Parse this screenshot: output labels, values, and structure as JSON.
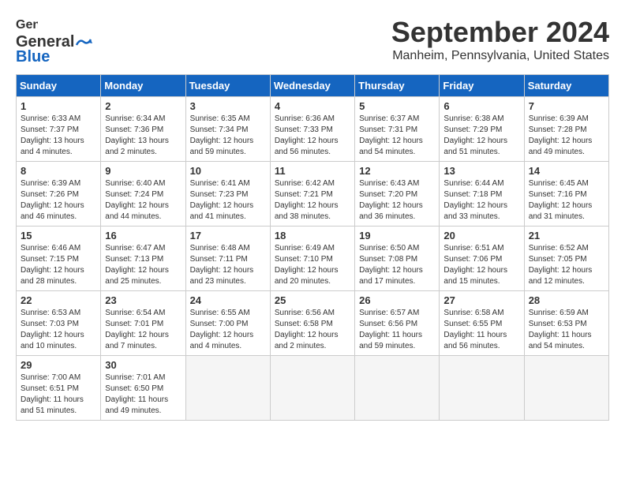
{
  "logo": {
    "general": "General",
    "blue": "Blue"
  },
  "title": "September 2024",
  "location": "Manheim, Pennsylvania, United States",
  "days_of_week": [
    "Sunday",
    "Monday",
    "Tuesday",
    "Wednesday",
    "Thursday",
    "Friday",
    "Saturday"
  ],
  "weeks": [
    [
      {
        "day": "1",
        "info": "Sunrise: 6:33 AM\nSunset: 7:37 PM\nDaylight: 13 hours and 4 minutes."
      },
      {
        "day": "2",
        "info": "Sunrise: 6:34 AM\nSunset: 7:36 PM\nDaylight: 13 hours and 2 minutes."
      },
      {
        "day": "3",
        "info": "Sunrise: 6:35 AM\nSunset: 7:34 PM\nDaylight: 12 hours and 59 minutes."
      },
      {
        "day": "4",
        "info": "Sunrise: 6:36 AM\nSunset: 7:33 PM\nDaylight: 12 hours and 56 minutes."
      },
      {
        "day": "5",
        "info": "Sunrise: 6:37 AM\nSunset: 7:31 PM\nDaylight: 12 hours and 54 minutes."
      },
      {
        "day": "6",
        "info": "Sunrise: 6:38 AM\nSunset: 7:29 PM\nDaylight: 12 hours and 51 minutes."
      },
      {
        "day": "7",
        "info": "Sunrise: 6:39 AM\nSunset: 7:28 PM\nDaylight: 12 hours and 49 minutes."
      }
    ],
    [
      {
        "day": "8",
        "info": "Sunrise: 6:39 AM\nSunset: 7:26 PM\nDaylight: 12 hours and 46 minutes."
      },
      {
        "day": "9",
        "info": "Sunrise: 6:40 AM\nSunset: 7:24 PM\nDaylight: 12 hours and 44 minutes."
      },
      {
        "day": "10",
        "info": "Sunrise: 6:41 AM\nSunset: 7:23 PM\nDaylight: 12 hours and 41 minutes."
      },
      {
        "day": "11",
        "info": "Sunrise: 6:42 AM\nSunset: 7:21 PM\nDaylight: 12 hours and 38 minutes."
      },
      {
        "day": "12",
        "info": "Sunrise: 6:43 AM\nSunset: 7:20 PM\nDaylight: 12 hours and 36 minutes."
      },
      {
        "day": "13",
        "info": "Sunrise: 6:44 AM\nSunset: 7:18 PM\nDaylight: 12 hours and 33 minutes."
      },
      {
        "day": "14",
        "info": "Sunrise: 6:45 AM\nSunset: 7:16 PM\nDaylight: 12 hours and 31 minutes."
      }
    ],
    [
      {
        "day": "15",
        "info": "Sunrise: 6:46 AM\nSunset: 7:15 PM\nDaylight: 12 hours and 28 minutes."
      },
      {
        "day": "16",
        "info": "Sunrise: 6:47 AM\nSunset: 7:13 PM\nDaylight: 12 hours and 25 minutes."
      },
      {
        "day": "17",
        "info": "Sunrise: 6:48 AM\nSunset: 7:11 PM\nDaylight: 12 hours and 23 minutes."
      },
      {
        "day": "18",
        "info": "Sunrise: 6:49 AM\nSunset: 7:10 PM\nDaylight: 12 hours and 20 minutes."
      },
      {
        "day": "19",
        "info": "Sunrise: 6:50 AM\nSunset: 7:08 PM\nDaylight: 12 hours and 17 minutes."
      },
      {
        "day": "20",
        "info": "Sunrise: 6:51 AM\nSunset: 7:06 PM\nDaylight: 12 hours and 15 minutes."
      },
      {
        "day": "21",
        "info": "Sunrise: 6:52 AM\nSunset: 7:05 PM\nDaylight: 12 hours and 12 minutes."
      }
    ],
    [
      {
        "day": "22",
        "info": "Sunrise: 6:53 AM\nSunset: 7:03 PM\nDaylight: 12 hours and 10 minutes."
      },
      {
        "day": "23",
        "info": "Sunrise: 6:54 AM\nSunset: 7:01 PM\nDaylight: 12 hours and 7 minutes."
      },
      {
        "day": "24",
        "info": "Sunrise: 6:55 AM\nSunset: 7:00 PM\nDaylight: 12 hours and 4 minutes."
      },
      {
        "day": "25",
        "info": "Sunrise: 6:56 AM\nSunset: 6:58 PM\nDaylight: 12 hours and 2 minutes."
      },
      {
        "day": "26",
        "info": "Sunrise: 6:57 AM\nSunset: 6:56 PM\nDaylight: 11 hours and 59 minutes."
      },
      {
        "day": "27",
        "info": "Sunrise: 6:58 AM\nSunset: 6:55 PM\nDaylight: 11 hours and 56 minutes."
      },
      {
        "day": "28",
        "info": "Sunrise: 6:59 AM\nSunset: 6:53 PM\nDaylight: 11 hours and 54 minutes."
      }
    ],
    [
      {
        "day": "29",
        "info": "Sunrise: 7:00 AM\nSunset: 6:51 PM\nDaylight: 11 hours and 51 minutes."
      },
      {
        "day": "30",
        "info": "Sunrise: 7:01 AM\nSunset: 6:50 PM\nDaylight: 11 hours and 49 minutes."
      },
      null,
      null,
      null,
      null,
      null
    ]
  ]
}
